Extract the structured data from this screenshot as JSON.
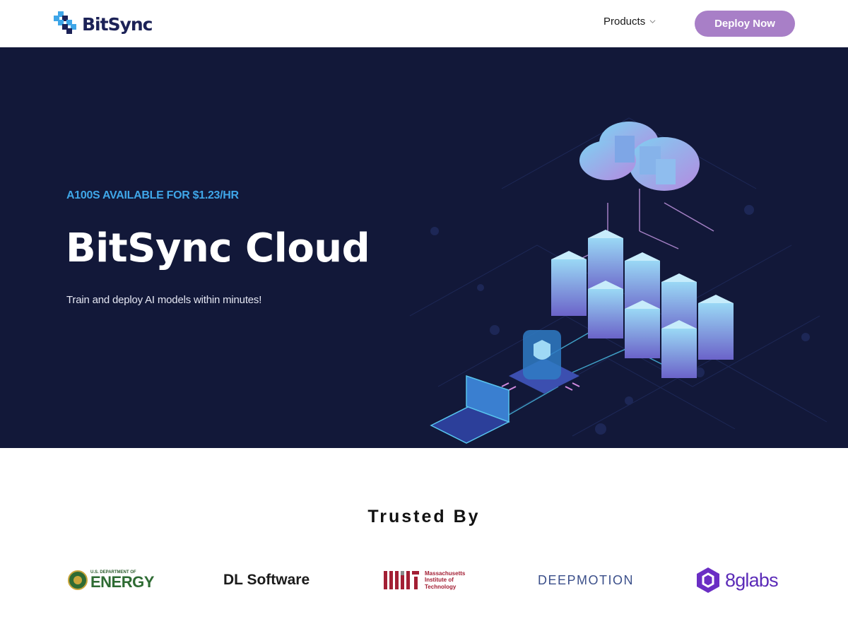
{
  "header": {
    "brand": "BitSync",
    "nav_products": "Products",
    "deploy_label": "Deploy Now",
    "icons": {
      "logo": "bitsync-logo-icon",
      "chevron": "chevron-down-icon"
    }
  },
  "hero": {
    "eyebrow": "A100S AVAILABLE FOR $1.23/HR",
    "title": "BitSync Cloud",
    "subtitle": "Train and deploy AI models within minutes!",
    "illustration": "isometric-cloud-servers-illustration"
  },
  "trusted": {
    "title": "Trusted By",
    "partners": [
      {
        "name": "U.S. DEPARTMENT OF ENERGY",
        "small": "U.S. DEPARTMENT OF",
        "big": "ENERGY"
      },
      {
        "name": "DL Software"
      },
      {
        "name": "Massachusetts Institute of Technology",
        "lines": [
          "Massachusetts",
          "Institute of",
          "Technology"
        ]
      },
      {
        "name": "DEEPMOTION"
      },
      {
        "name": "8glabs"
      }
    ]
  },
  "colors": {
    "brand_navy": "#1c2257",
    "accent_purple": "#a87fc7",
    "hero_bg": "#121839",
    "eyebrow_blue": "#3fa6e8"
  }
}
